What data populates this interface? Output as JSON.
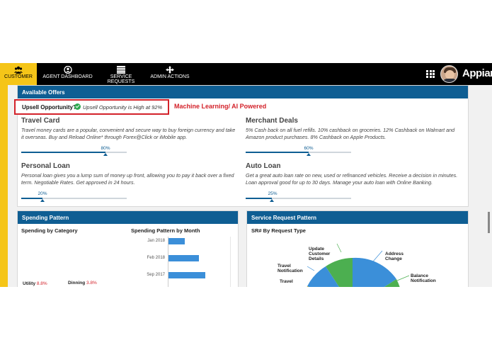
{
  "nav": {
    "items": [
      {
        "label": "CUSTOMER",
        "icon": "people-icon",
        "active": true
      },
      {
        "label": "AGENT DASHBOARD",
        "icon": "agent-icon",
        "active": false
      },
      {
        "label": "SERVICE REQUESTS",
        "icon": "list-icon",
        "active": false
      },
      {
        "label": "ADMIN ACTIONS",
        "icon": "move-icon",
        "active": false
      }
    ],
    "brand": "Appian",
    "accent_color": "#f5c518",
    "header_color": "#0f5e93"
  },
  "offers": {
    "header": "Available Offers",
    "upsell_label": "Upsell Opportunity?",
    "upsell_status": "Upsell Opportunity is High at 92%",
    "annotation": "Machine Learning/ AI Powered",
    "items": [
      {
        "title": "Travel Card",
        "desc_line1": "Travel money cards are a popular, convenient and secure way to buy foreign currency and take",
        "desc_line2": "it overseas. Buy and Reload Online* through Forex@Click or iMobile app.",
        "percent_label": "80%",
        "percent": 80
      },
      {
        "title": "Merchant Deals",
        "desc_line1": "5% Cash back on all fuel refills. 10% cashback on groceries. 12% Cashback on Walmart and",
        "desc_line2": "Amazon product purchases. 8% Cashback on Apple Products.",
        "percent_label": "60%",
        "percent": 60
      },
      {
        "title": "Personal Loan",
        "desc_line1": "Personal loan gives you a lump sum of money up front, allowing you to pay it back over a fixed",
        "desc_line2": "term. Negotiable Rates. Get approved in 24 hours.",
        "percent_label": "20%",
        "percent": 20
      },
      {
        "title": "Auto Loan",
        "desc_line1": "Get a great auto loan rate on new, used or refinanced vehicles. Receive a decision in minutes.",
        "desc_line2": "Loan approval good for up to 30 days. Manage your auto loan with Online Banking.",
        "percent_label": "25%",
        "percent": 25
      }
    ]
  },
  "spending": {
    "header": "Spending Pattern",
    "by_category_title": "Spending by Category",
    "by_month_title": "Spending Pattern by Month",
    "legend": [
      {
        "name": "Utility",
        "value": "8.8%"
      },
      {
        "name": "Dinning",
        "value": "3.8%"
      }
    ]
  },
  "service_requests": {
    "header": "Service Request Pattern",
    "subtitle": "SR# By Request Type",
    "pie_labels": [
      {
        "l1": "Update",
        "l2": "Customer",
        "l3": "Details"
      },
      {
        "l1": "Address",
        "l2": "Change",
        "l3": ""
      },
      {
        "l1": "Travel",
        "l2": "Notification",
        "l3": ""
      },
      {
        "l1": "Balance",
        "l2": "Notification",
        "l3": ""
      },
      {
        "l1": "Travel",
        "l2": "",
        "l3": ""
      }
    ]
  },
  "chart_data": {
    "type": "bar",
    "title": "Spending Pattern by Month",
    "categories": [
      "Jan 2018",
      "Feb 2018",
      "Sep 2017"
    ],
    "values": [
      22,
      42,
      50
    ],
    "xlim": [
      0,
      85
    ]
  }
}
